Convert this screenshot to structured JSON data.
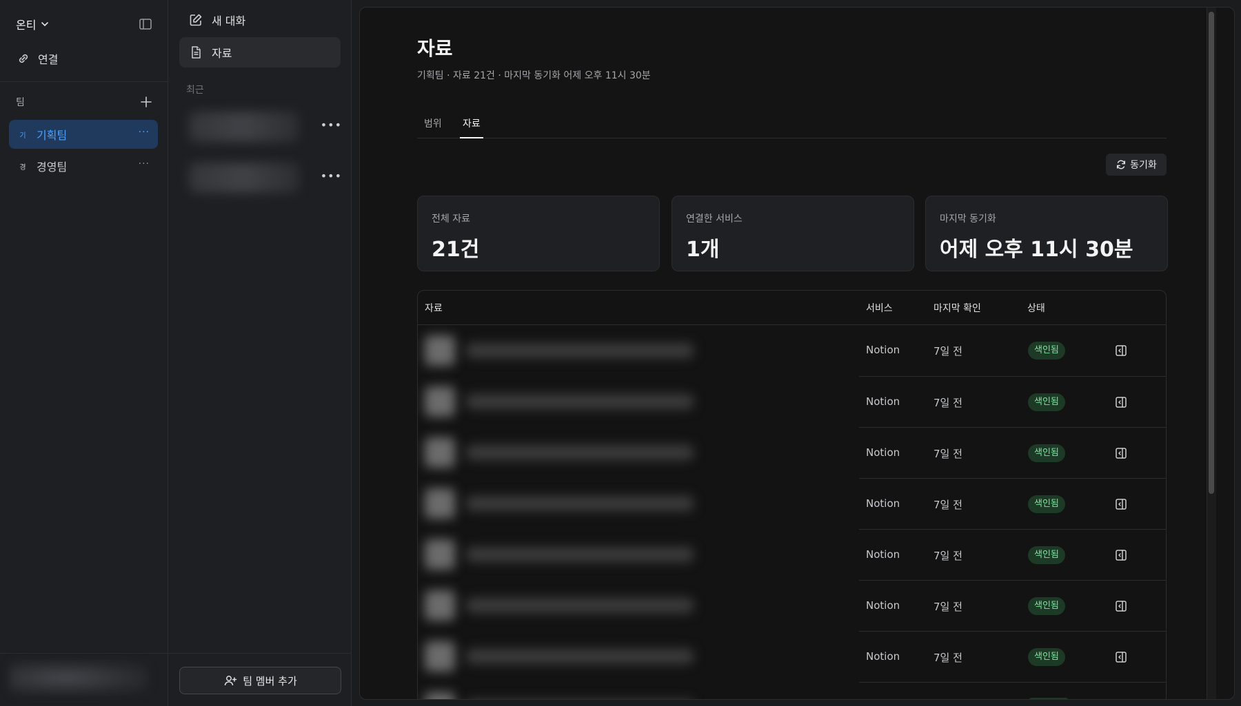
{
  "sidebar": {
    "workspace": "온티",
    "connect_label": "연결",
    "team_header": "팀",
    "teams": [
      {
        "initial": "기",
        "name": "기획팀",
        "active": true
      },
      {
        "initial": "경",
        "name": "경영팀",
        "active": false
      }
    ]
  },
  "col2": {
    "new_chat": "새 대화",
    "docs": "자료",
    "recent_label": "최근",
    "add_member": "팀 멤버 추가"
  },
  "main": {
    "title": "자료",
    "subtitle": "기획팀 · 자료 21건 · 마지막 동기화 어제 오후 11시 30분",
    "tabs": [
      "범위",
      "자료"
    ],
    "active_tab": 1,
    "sync_label": "동기화",
    "stats": [
      {
        "label": "전체 자료",
        "value": "21건"
      },
      {
        "label": "연결한 서비스",
        "value": "1개"
      },
      {
        "label": "마지막 동기화",
        "value": "어제 오후 11시 30분"
      }
    ],
    "table": {
      "headers": [
        "자료",
        "서비스",
        "마지막 확인",
        "상태"
      ],
      "rows": [
        {
          "service": "Notion",
          "checked": "7일 전",
          "status": "색인됨"
        },
        {
          "service": "Notion",
          "checked": "7일 전",
          "status": "색인됨"
        },
        {
          "service": "Notion",
          "checked": "7일 전",
          "status": "색인됨"
        },
        {
          "service": "Notion",
          "checked": "7일 전",
          "status": "색인됨"
        },
        {
          "service": "Notion",
          "checked": "7일 전",
          "status": "색인됨"
        },
        {
          "service": "Notion",
          "checked": "7일 전",
          "status": "색인됨"
        },
        {
          "service": "Notion",
          "checked": "7일 전",
          "status": "색인됨"
        }
      ]
    }
  },
  "colors": {
    "accent": "#4ea1ff",
    "badge_bg": "#1d3a26",
    "badge_text": "#7ee2a0"
  }
}
